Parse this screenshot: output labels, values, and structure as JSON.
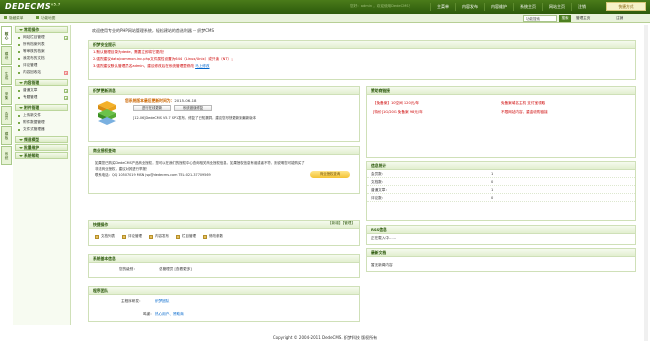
{
  "header": {
    "logo": "DEDECMS",
    "logo_version": "v5.7",
    "userinfo": "您好：admin ，欢迎使用DedeCMS！",
    "nav": [
      "主菜单",
      "内容发布",
      "系统",
      "功能",
      "模块",
      "生成",
      "会员"
    ],
    "nav_full": [
      "主菜单",
      "内容发布",
      "内容维护",
      "系统主页",
      "网站主页",
      "注销"
    ],
    "quick_label": "快捷方式"
  },
  "subbar": {
    "link_left": "隐藏菜单",
    "link_mid": "功能地图",
    "search_placeholder": "功能搜索",
    "search_button": "搜索",
    "right1": "管理主页",
    "right2": "注销"
  },
  "vtabs": [
    "核心",
    "模块",
    "生成",
    "采集",
    "会员",
    "模板",
    "系统"
  ],
  "sidebar": {
    "sections": [
      {
        "title": "常用操作",
        "items": [
          "网站栏目管理",
          "所有档案列表",
          "等审核的档案",
          "我发布的文档",
          "评论管理",
          "内容回收站"
        ]
      },
      {
        "title": "内容管理",
        "items": [
          "普通文章",
          "专题管理"
        ]
      },
      {
        "title": "附件管理",
        "items": [
          "上传新文件",
          "附件数据管理",
          "文件式管理器"
        ]
      },
      {
        "title": "频道模型",
        "items": []
      },
      {
        "title": "批量维护",
        "items": []
      },
      {
        "title": "系统帮助",
        "items": []
      }
    ]
  },
  "welcome": "欢迎使用专业的PHP网站管理系统，轻松建站的首选利器 -- 织梦CMS",
  "security": {
    "title": "织梦安全提示",
    "lines": [
      "1.默认管理目录为dede，需要立即将它更改！",
      "2.强烈建议data/common.inc.php文件属性设置为644（Linux/Unix）或只读（NT）；",
      "3.强烈建议默认管理员名admin，建议修改后在系统管理里修改"
    ],
    "link": "马上修改"
  },
  "update": {
    "title": "织梦更新消息",
    "headline": "您系统版本最后更新时间为：",
    "date": "2015-06-18",
    "btn_check": "进行在线更新",
    "btn_sys": "系统错误修复",
    "text": "[12-06]DedeCMS V5.7 SP1发布，修复了已知漏洞，建议您尽快更新到最新版本"
  },
  "commercial": {
    "title": "商业授权查询",
    "text1": "如果您已购买DedeCMS产品商业授权，您可以在我们的授权中心查询相关商业授权信息，如果授权信息有误或者不符，则说明您可能购买了非法商业授权，建议对其进行举报！",
    "text2": "联系电话：QQ 10507019 MSN jsp@dedecms.com TEL:021-37709569",
    "btn": "商业授权查询"
  },
  "quick": {
    "title": "快捷操作",
    "right": "【新增】【管理】",
    "links": [
      "文档列表",
      "评论管理",
      "内容发布",
      "栏目管理",
      "修改参数"
    ]
  },
  "sysinfo": {
    "title": "系统基本信息",
    "label": "您的级别：",
    "value": "总管理员 [查看更多]"
  },
  "team": {
    "title": "程序团队",
    "row1_label": "主程序研发：",
    "row1_value": "织梦团队",
    "row2_label": "鸣谢：",
    "row2_value": "热心用户、赞助商"
  },
  "sponsor": {
    "title": "赞助商链接",
    "left1": "【免备案】10空间 120元/年",
    "left2": "[特价]1G/20G 免备案 98元/年",
    "right1": "免备案域名主机 支付宝领取",
    "right2": "不限网站内容，重金收购链接"
  },
  "stats": {
    "title": "信息统计",
    "rows": [
      {
        "label": "会员数：",
        "value": "1"
      },
      {
        "label": "文档数：",
        "value": "0"
      },
      {
        "label": "普通文章：",
        "value": "1"
      },
      {
        "label": "评论数：",
        "value": "0"
      }
    ]
  },
  "rss": {
    "title": "RSS信息",
    "text": "正在载入中……"
  },
  "latest": {
    "title": "最新文档",
    "text": "暂无新闻内容"
  },
  "footer": {
    "text": "Copyright © 2004-2011 DedeCMS. 织梦科技 版权所有"
  }
}
